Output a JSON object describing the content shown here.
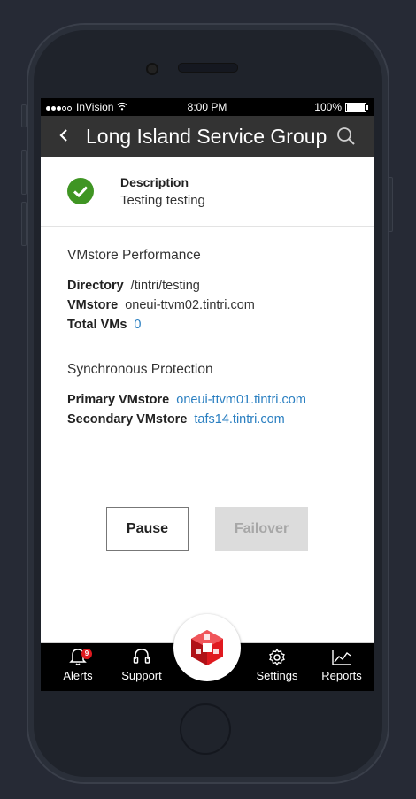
{
  "status_bar": {
    "carrier": "InVision",
    "time": "8:00 PM",
    "battery": "100%"
  },
  "header": {
    "title": "Long Island Service Group",
    "back_icon": "chevron-left-icon",
    "search_icon": "search-icon"
  },
  "description": {
    "label": "Description",
    "value": "Testing testing",
    "status_icon": "check-circle-icon",
    "status_color": "#3f9523"
  },
  "performance": {
    "title": "VMstore Performance",
    "directory_label": "Directory",
    "directory_value": "/tintri/testing",
    "vmstore_label": "VMstore",
    "vmstore_value": "oneui-ttvm02.tintri.com",
    "total_vms_label": "Total VMs",
    "total_vms_value": "0"
  },
  "protection": {
    "title": "Synchronous Protection",
    "primary_label": "Primary VMstore",
    "primary_value": "oneui-ttvm01.tintri.com",
    "secondary_label": "Secondary VMstore",
    "secondary_value": "tafs14.tintri.com"
  },
  "actions": {
    "pause_label": "Pause",
    "failover_label": "Failover"
  },
  "tab_bar": {
    "alerts_label": "Alerts",
    "alerts_badge": "9",
    "support_label": "Support",
    "settings_label": "Settings",
    "reports_label": "Reports"
  },
  "colors": {
    "link": "#2a7fc1",
    "nav_bg": "#333333",
    "badge": "#e0191f",
    "brand": "#e0191f"
  }
}
